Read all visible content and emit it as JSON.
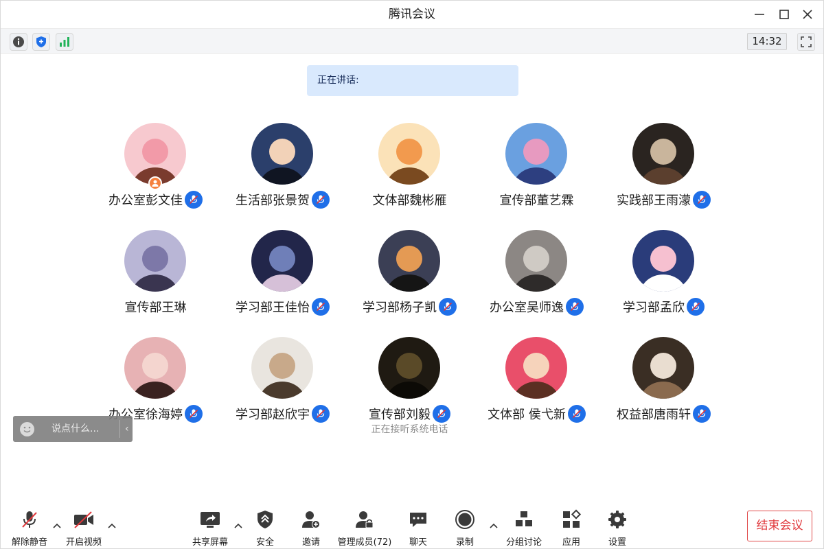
{
  "window": {
    "title": "腾讯会议"
  },
  "infobar": {
    "clock": "14:32"
  },
  "speaking": {
    "label": "正在讲话:"
  },
  "participants": [
    {
      "name": "办公室彭文佳",
      "muted": true,
      "host": true
    },
    {
      "name": "生活部张景贺",
      "muted": true
    },
    {
      "name": "文体部魏彬雁",
      "muted": false
    },
    {
      "name": "宣传部董艺霖",
      "muted": false
    },
    {
      "name": "实践部王雨濛",
      "muted": true
    },
    {
      "name": "宣传部王琳",
      "muted": false
    },
    {
      "name": "学习部王佳怡",
      "muted": true
    },
    {
      "name": "学习部杨子凯",
      "muted": true
    },
    {
      "name": "办公室吴师逸",
      "muted": true
    },
    {
      "name": "学习部孟欣",
      "muted": true
    },
    {
      "name": "办公室徐海婷",
      "muted": true
    },
    {
      "name": "学习部赵欣宇",
      "muted": true
    },
    {
      "name": "宣传部刘毅",
      "muted": true,
      "status": "正在接听系统电话"
    },
    {
      "name": "文体部 侯弋新",
      "muted": true
    },
    {
      "name": "权益部唐雨轩",
      "muted": true
    }
  ],
  "chat": {
    "placeholder": "说点什么..."
  },
  "toolbar": {
    "unmute": "解除静音",
    "video": "开启视频",
    "share": "共享屏幕",
    "security": "安全",
    "invite": "邀请",
    "members": "管理成员(72)",
    "chat": "聊天",
    "record": "录制",
    "breakout": "分组讨论",
    "apps": "应用",
    "settings": "设置",
    "end": "结束会议"
  },
  "colors": {
    "accent": "#1f6fe8",
    "end": "#e0363a",
    "banner": "#d9e9fd",
    "host": "#f5803e"
  }
}
